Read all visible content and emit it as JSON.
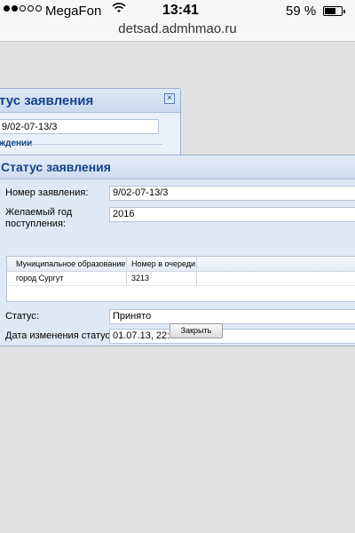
{
  "status_bar": {
    "carrier": "MegaFon",
    "time": "13:41",
    "battery": "59 %",
    "battery_level": 0.59
  },
  "browser": {
    "url": "detsad.admhmao.ru"
  },
  "bg_dialog": {
    "title": "тус заявления",
    "number_value": "9/02-07-13/3",
    "section_legend": "ждении"
  },
  "dialog": {
    "title": "Статус заявления",
    "fields": {
      "number_label": "Номер заявления:",
      "number_value": "9/02-07-13/3",
      "year_label_line1": "Желаемый год",
      "year_label_line2": "поступления:",
      "year_value": "2016",
      "status_label": "Статус:",
      "status_value": "Принято",
      "date_label": "Дата изменения статуса:",
      "date_value": "01.07.13, 22:14"
    },
    "table": {
      "headers": [
        "Муниципальное образование",
        "Номер в очереди"
      ],
      "rows": [
        [
          "город Сургут",
          "3213"
        ]
      ]
    },
    "close_button": "Закрыть"
  }
}
